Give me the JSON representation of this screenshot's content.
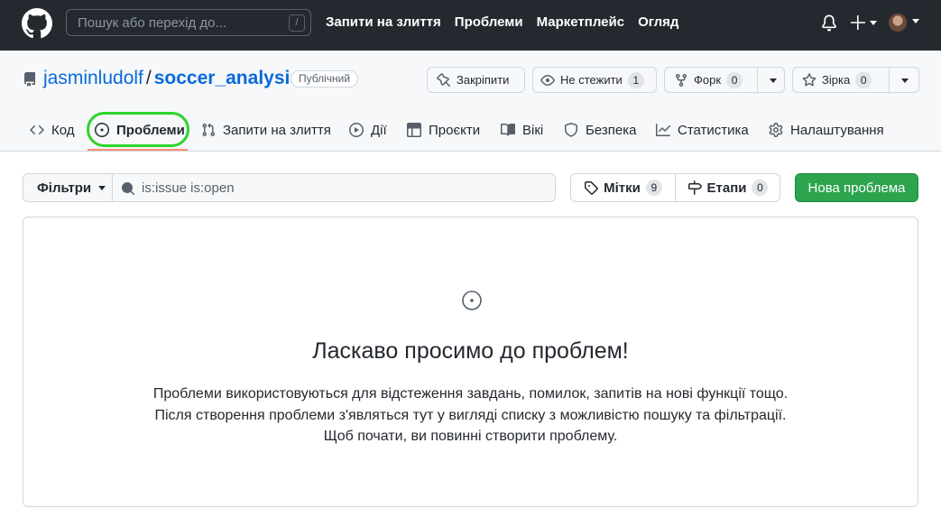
{
  "header": {
    "search_placeholder": "Пошук або перехід до...",
    "search_shortcut": "/",
    "nav": [
      "Запити на злиття",
      "Проблеми",
      "Маркетплейс",
      "Огляд"
    ]
  },
  "repo": {
    "owner": "jasminludolf",
    "separator": "/",
    "name": "soccer_analysis",
    "visibility": "Публічний",
    "pin_label": "Закріпити",
    "watch_label": "Не стежити",
    "watch_count": "1",
    "fork_label": "Форк",
    "fork_count": "0",
    "star_label": "Зірка",
    "star_count": "0"
  },
  "tabs": [
    {
      "label": "Код",
      "icon": "code-icon"
    },
    {
      "label": "Проблеми",
      "icon": "issue-opened-icon",
      "selected": true
    },
    {
      "label": "Запити на злиття",
      "icon": "pull-request-icon"
    },
    {
      "label": "Дії",
      "icon": "play-icon"
    },
    {
      "label": "Проєкти",
      "icon": "table-icon"
    },
    {
      "label": "Вікі",
      "icon": "book-icon"
    },
    {
      "label": "Безпека",
      "icon": "shield-icon"
    },
    {
      "label": "Статистика",
      "icon": "graph-icon"
    },
    {
      "label": "Налаштування",
      "icon": "gear-icon"
    }
  ],
  "issues_bar": {
    "filters_label": "Фільтри",
    "search_value": "is:issue is:open",
    "labels_label": "Мітки",
    "labels_count": "9",
    "milestones_label": "Етапи",
    "milestones_count": "0",
    "new_issue_label": "Нова проблема"
  },
  "blankslate": {
    "title": "Ласкаво просимо до проблем!",
    "lines": [
      "Проблеми використовуються для відстеження завдань, помилок, запитів на нові функції тощо.",
      "Після створення проблеми з'являться тут у вигляді списку з можливістю пошуку та фільтрації.",
      "Щоб почати, ви повинні створити проблему."
    ]
  },
  "colors": {
    "header_bg": "#24292f",
    "link": "#0969da",
    "primary_button": "#2da44e",
    "tab_underline": "#fd8c73",
    "highlight_ring": "#2ed42b"
  }
}
